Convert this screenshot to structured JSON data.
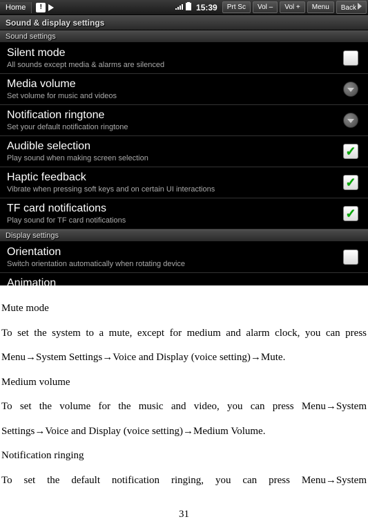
{
  "statusbar": {
    "home": "Home",
    "time": "15:39",
    "buttons": {
      "prtsc": "Prt Sc",
      "voldown": "Vol –",
      "volup": "Vol +",
      "menu": "Menu",
      "back": "Back"
    }
  },
  "headers": {
    "main": "Sound & display settings",
    "sound": "Sound settings",
    "display": "Display settings"
  },
  "items": {
    "silent": {
      "title": "Silent mode",
      "desc": "All sounds except media & alarms are silenced"
    },
    "media": {
      "title": "Media volume",
      "desc": "Set volume for music and videos"
    },
    "notif": {
      "title": "Notification ringtone",
      "desc": "Set your default notification ringtone"
    },
    "audible": {
      "title": "Audible selection",
      "desc": "Play sound when making screen selection"
    },
    "haptic": {
      "title": "Haptic feedback",
      "desc": "Vibrate when pressing soft keys and on certain UI interactions"
    },
    "tfcard": {
      "title": "TF card notifications",
      "desc": "Play sound for TF card notifications"
    },
    "orient": {
      "title": "Orientation",
      "desc": "Switch orientation automatically when rotating device"
    },
    "anim": {
      "title": "Animation"
    }
  },
  "doc": {
    "h1": "Mute mode",
    "p1": "To set the system to a mute, except for medium and alarm clock, you can press",
    "p2": "Menu→System Settings→Voice and Display (voice setting)→Mute.",
    "h2": "Medium volume",
    "p3": "To set the volume for the music and video, you can press Menu→System",
    "p4": "Settings→Voice and Display (voice setting)→Medium Volume.",
    "h3": "Notification ringing",
    "p5": "To set the default notification ringing, you can press Menu→System",
    "pagenum": "31"
  }
}
